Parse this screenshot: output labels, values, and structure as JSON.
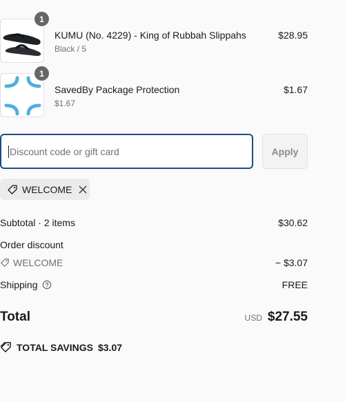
{
  "line_items": [
    {
      "title": "KUMU (No. 4229) - King of Rubbah Slippahs",
      "subtitle": "Black / 5",
      "price": "$28.95",
      "quantity": "1",
      "image_icon": "sandal-product-image"
    },
    {
      "title": "SavedBy Package Protection",
      "subtitle": "$1.67",
      "price": "$1.67",
      "quantity": "1",
      "image_icon": "package-protection-logo"
    }
  ],
  "discount": {
    "placeholder": "Discount code or gift card",
    "value": "",
    "apply_label": "Apply",
    "applied_code": "WELCOME"
  },
  "summary": {
    "subtotal_label": "Subtotal · 2 items",
    "subtotal_value": "$30.62",
    "order_discount_label": "Order discount",
    "discount_code": "WELCOME",
    "discount_value": "− $3.07",
    "shipping_label": "Shipping",
    "shipping_value": "FREE",
    "total_label": "Total",
    "currency": "USD",
    "total_value": "$27.55",
    "savings_label": "TOTAL SAVINGS",
    "savings_value": "$3.07"
  },
  "colors": {
    "focus_border": "#1c4b80",
    "badge": "#666666",
    "protection_logo": "#4fb0dd"
  }
}
